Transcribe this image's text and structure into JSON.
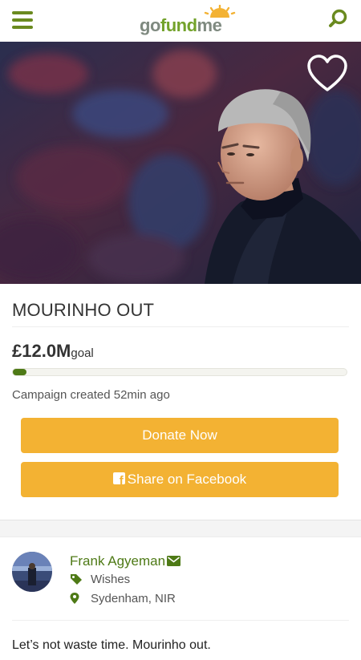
{
  "header": {
    "logo": {
      "part_go": "go",
      "part_fund": "fund",
      "part_me": "me"
    },
    "menu_icon": "hamburger-menu-icon",
    "search_icon": "search-icon"
  },
  "hero": {
    "image": "photo of a grey-haired man in a dark coat in a stadium",
    "favorite_icon": "heart-outline-icon"
  },
  "campaign": {
    "title": "MOURINHO OUT",
    "goal_amount": "£12.0M",
    "goal_label": "goal",
    "progress_percent": 1,
    "created": "Campaign created 52min ago"
  },
  "actions": {
    "donate_label": "Donate Now",
    "share_label": "Share on Facebook",
    "share_icon": "facebook-icon"
  },
  "organizer": {
    "name": "Frank Agyeman",
    "name_icon": "envelope-icon",
    "category": "Wishes",
    "category_icon": "tag-icon",
    "location": "Sydenham, NIR",
    "location_icon": "map-pin-icon"
  },
  "story": {
    "text": "Let’s not waste time. Mourinho out."
  },
  "colors": {
    "brand_green": "#73a22b",
    "dark_green": "#4e7a16",
    "button_orange": "#f3b233",
    "logo_grey": "#7f8a80"
  }
}
